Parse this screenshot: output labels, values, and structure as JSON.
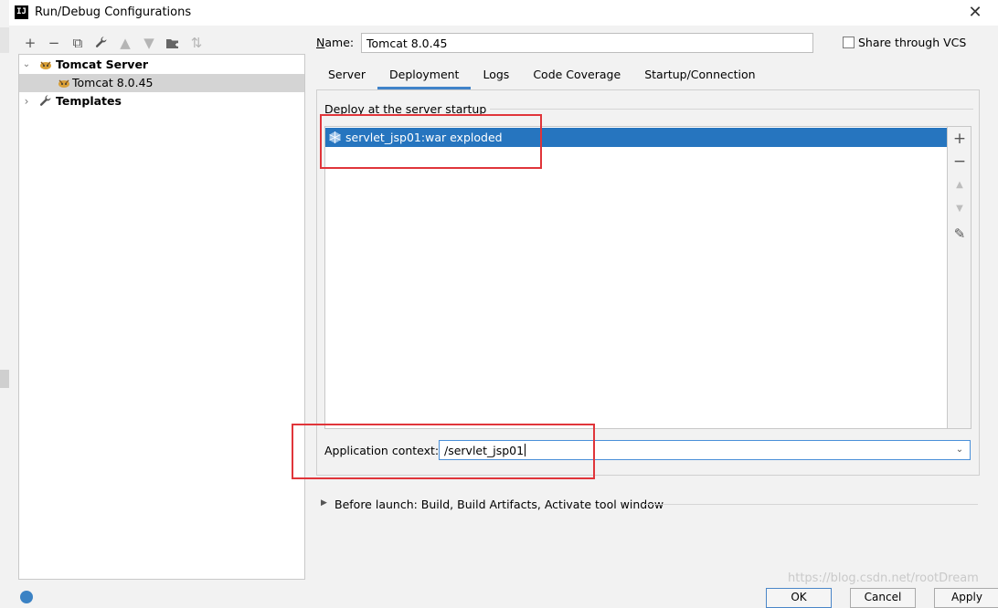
{
  "window": {
    "title": "Run/Debug Configurations",
    "app_icon_text": "IJ"
  },
  "toolbar": {
    "buttons": [
      {
        "name": "add",
        "glyph": "+",
        "enabled": true
      },
      {
        "name": "remove",
        "glyph": "−",
        "enabled": true
      },
      {
        "name": "copy",
        "glyph": "⧉",
        "enabled": true
      },
      {
        "name": "edit-defaults",
        "glyph": "🔧",
        "enabled": true
      },
      {
        "name": "move-up",
        "glyph": "▲",
        "enabled": false
      },
      {
        "name": "move-down",
        "glyph": "▼",
        "enabled": false
      },
      {
        "name": "new-folder",
        "glyph": "▣",
        "enabled": true
      },
      {
        "name": "sort",
        "glyph": "⇅",
        "enabled": false
      }
    ]
  },
  "tree": {
    "items": [
      {
        "label": "Tomcat Server",
        "expanded": true,
        "bold": true,
        "icon": "tomcat-icon"
      },
      {
        "label": "Tomcat 8.0.45",
        "selected": true,
        "icon": "tomcat-icon"
      },
      {
        "label": "Templates",
        "expanded": false,
        "bold": true,
        "icon": "wrench-icon"
      }
    ]
  },
  "name_field": {
    "label": "Name:",
    "value": "Tomcat 8.0.45"
  },
  "share_vcs": {
    "label": "Share through VCS",
    "checked": false
  },
  "tabs": [
    {
      "label": "Server",
      "active": false
    },
    {
      "label": "Deployment",
      "active": true
    },
    {
      "label": "Logs",
      "active": false
    },
    {
      "label": "Code Coverage",
      "active": false
    },
    {
      "label": "Startup/Connection",
      "active": false
    }
  ],
  "deployment": {
    "section_title": "Deploy at the server startup",
    "artifacts": [
      {
        "label": "servlet_jsp01:war exploded",
        "selected": true
      }
    ],
    "side_tools": [
      "+",
      "−",
      "▲",
      "▼",
      "✎"
    ]
  },
  "app_context": {
    "label": "Application context:",
    "value": "/servlet_jsp01"
  },
  "before_launch": {
    "label": "Before launch: Build, Build Artifacts, Activate tool window"
  },
  "bottom_buttons": {
    "ok": "OK",
    "cancel": "Cancel",
    "apply": "Apply"
  },
  "watermark": "https://blog.csdn.net/rootDream",
  "colors": {
    "accent": "#2675bf",
    "highlight_box": "#e0353a",
    "tab_underline": "#4083c9"
  }
}
